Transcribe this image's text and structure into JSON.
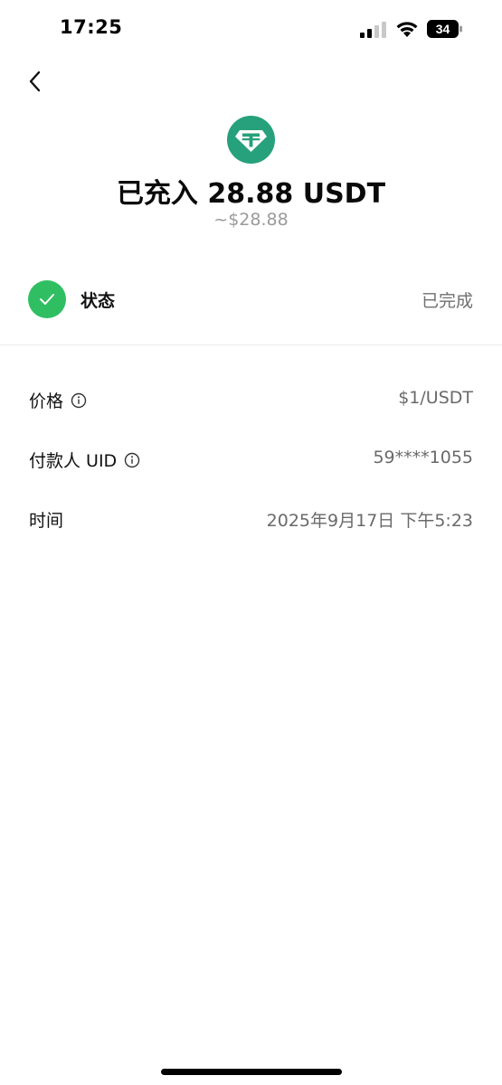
{
  "status_bar": {
    "time": "17:25",
    "battery": "34"
  },
  "header": {
    "coin_icon": "tether-icon",
    "title": "已充入 28.88 USDT",
    "fiat_value": "~$28.88"
  },
  "status": {
    "label": "状态",
    "value": "已完成",
    "icon": "check-icon",
    "color": "#2fbf62"
  },
  "details": [
    {
      "label": "价格",
      "value": "$1/USDT",
      "has_info": true
    },
    {
      "label": "付款人 UID",
      "value": "59****1055",
      "has_info": true
    },
    {
      "label": "时间",
      "value": "2025年9月17日 下午5:23",
      "has_info": false
    }
  ],
  "colors": {
    "tether": "#26a17b",
    "success": "#2fbf62"
  }
}
